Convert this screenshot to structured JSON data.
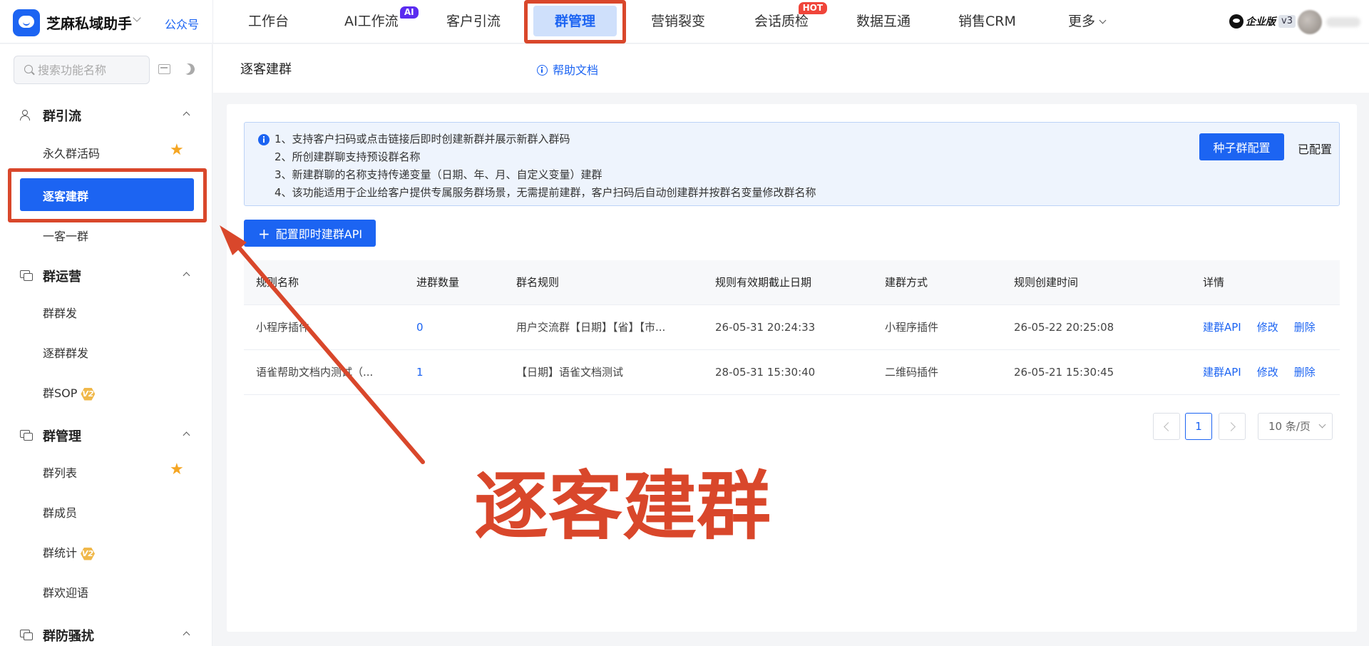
{
  "brand": {
    "name": "芝麻私域助手",
    "gzh": "公众号"
  },
  "nav": [
    {
      "label": "工作台"
    },
    {
      "label": "AI工作流",
      "badge": "AI"
    },
    {
      "label": "客户引流"
    },
    {
      "label": "群管理",
      "active": true
    },
    {
      "label": "营销裂变"
    },
    {
      "label": "会话质检",
      "badge": "HOT"
    },
    {
      "label": "数据互通"
    },
    {
      "label": "销售CRM"
    },
    {
      "label": "更多"
    }
  ],
  "account": {
    "edition": "企业版",
    "version": "v3"
  },
  "sidebar": {
    "search_placeholder": "搜索功能名称",
    "groups": [
      {
        "label": "群引流",
        "items": [
          {
            "label": "永久群活码",
            "starred": true
          },
          {
            "label": "逐客建群",
            "active": true
          },
          {
            "label": "一客一群"
          }
        ]
      },
      {
        "label": "群运营",
        "items": [
          {
            "label": "群群发"
          },
          {
            "label": "逐群群发"
          },
          {
            "label": "群SOP",
            "tag": "V2"
          }
        ]
      },
      {
        "label": "群管理",
        "items": [
          {
            "label": "群列表",
            "starred": true
          },
          {
            "label": "群成员"
          },
          {
            "label": "群统计",
            "tag": "V2"
          },
          {
            "label": "群欢迎语"
          }
        ]
      },
      {
        "label": "群防骚扰",
        "items": []
      }
    ]
  },
  "page": {
    "title": "逐客建群",
    "help": "帮助文档"
  },
  "notice": {
    "lines": [
      "1、支持客户扫码或点击链接后即时创建新群并展示新群入群码",
      "2、所创建群聊支持预设群名称",
      "3、新建群聊的名称支持传递变量（日期、年、月、自定义变量）建群",
      "4、该功能适用于企业给客户提供专属服务群场景，无需提前建群，客户扫码后自动创建群并按群名变量修改群名称"
    ],
    "seed_button": "种子群配置",
    "status": "已配置"
  },
  "api_button": "配置即时建群API",
  "table": {
    "columns": [
      "规则名称",
      "进群数量",
      "群名规则",
      "规则有效期截止日期",
      "建群方式",
      "规则创建时间",
      "详情"
    ],
    "rows": [
      {
        "name": "小程序插件",
        "count": "0",
        "rule": "用户交流群【日期】【省】【市...",
        "expire": "26-05-31 20:24:33",
        "method": "小程序插件",
        "created": "26-05-22 20:25:08"
      },
      {
        "name": "语雀帮助文档内测试（...",
        "count": "1",
        "rule": "【日期】语雀文档测试",
        "expire": "28-05-31 15:30:40",
        "method": "二维码插件",
        "created": "26-05-21 15:30:45"
      }
    ],
    "actions": [
      "建群API",
      "修改",
      "删除"
    ]
  },
  "pagination": {
    "current": "1",
    "page_size": "10 条/页"
  },
  "annotation": {
    "text": "逐客建群",
    "color": "#d9472b"
  },
  "colors": {
    "primary": "#1c64f2",
    "annotation": "#d9472b",
    "star": "#f5a623"
  }
}
